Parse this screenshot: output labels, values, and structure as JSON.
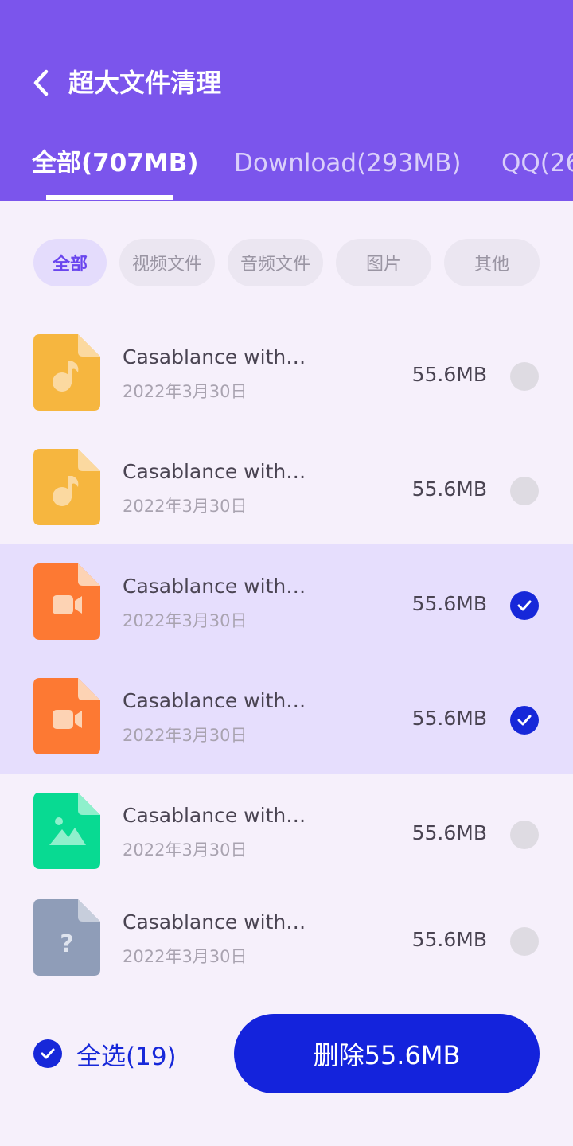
{
  "header": {
    "title": "超大文件清理",
    "tabs": [
      {
        "label": "全部(707MB)",
        "active": true
      },
      {
        "label": "Download(293MB)",
        "active": false
      },
      {
        "label": "QQ(26",
        "active": false
      }
    ]
  },
  "filters": [
    {
      "label": "全部",
      "active": true
    },
    {
      "label": "视频文件",
      "active": false
    },
    {
      "label": "音频文件",
      "active": false
    },
    {
      "label": "图片",
      "active": false
    },
    {
      "label": "其他",
      "active": false
    }
  ],
  "files": [
    {
      "name": "Casablance with…",
      "date": "2022年3月30日",
      "size": "55.6MB",
      "type": "audio",
      "selected": false
    },
    {
      "name": "Casablance with…",
      "date": "2022年3月30日",
      "size": "55.6MB",
      "type": "audio",
      "selected": false
    },
    {
      "name": "Casablance with…",
      "date": "2022年3月30日",
      "size": "55.6MB",
      "type": "video",
      "selected": true
    },
    {
      "name": "Casablance with…",
      "date": "2022年3月30日",
      "size": "55.6MB",
      "type": "video",
      "selected": true
    },
    {
      "name": "Casablance with…",
      "date": "2022年3月30日",
      "size": "55.6MB",
      "type": "image",
      "selected": false
    },
    {
      "name": "Casablance with…",
      "date": "2022年3月30日",
      "size": "55.6MB",
      "type": "other",
      "selected": false
    }
  ],
  "footer": {
    "select_all_label": "全选(19)",
    "delete_label": "删除55.6MB"
  },
  "colors": {
    "header_bg": "#7b55ec",
    "accent": "#1728d9",
    "selected_row_bg": "#e6defd",
    "audio_icon": "#f6b63f",
    "video_icon": "#fd7933",
    "image_icon": "#08da92",
    "other_icon": "#8f9db8"
  }
}
